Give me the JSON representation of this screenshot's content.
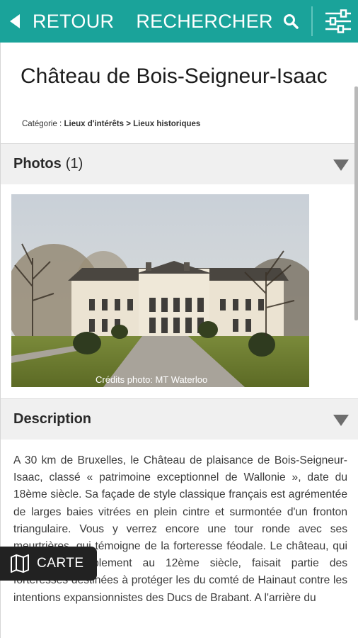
{
  "header": {
    "back_label": "RETOUR",
    "search_label": "RECHERCHER"
  },
  "place": {
    "title": "Château de Bois-Seigneur-Isaac",
    "category_prefix": "Catégorie :",
    "category_path": "Lieux d'intérêts > Lieux historiques"
  },
  "photos": {
    "label": "Photos",
    "count": "(1)",
    "credit": "Crédits photo: MT Waterloo"
  },
  "description": {
    "label": "Description",
    "text": "A 30 km de Bruxelles, le Château de plaisance de Bois-Seigneur-Isaac, classé « patrimoine exceptionnel de Wallonie », date du 18ème siècle. Sa façade de style classique français est agrémentée de larges baies vitrées en plein cintre et surmontée d'un fronton triangulaire. Vous y verrez encore une tour ronde avec ses meurtrières, qui témoigne de la forteresse féodale. Le château, qui remonte probablement au 12ème siècle, faisait partie des forteresses destinées à protéger les du comté de Hainaut contre les intentions expansionnistes des Ducs de Brabant. A l'arrière du"
  },
  "map_button": {
    "label": "CARTE"
  },
  "icons": {
    "back": "back-arrow-icon",
    "search": "search-icon",
    "filters": "filter-sliders-icon",
    "collapse": "triangle-down-icon",
    "map": "map-icon"
  },
  "colors": {
    "accent": "#1aa39a",
    "section_bg": "#f0f0f0",
    "map_button_bg": "#222222"
  }
}
